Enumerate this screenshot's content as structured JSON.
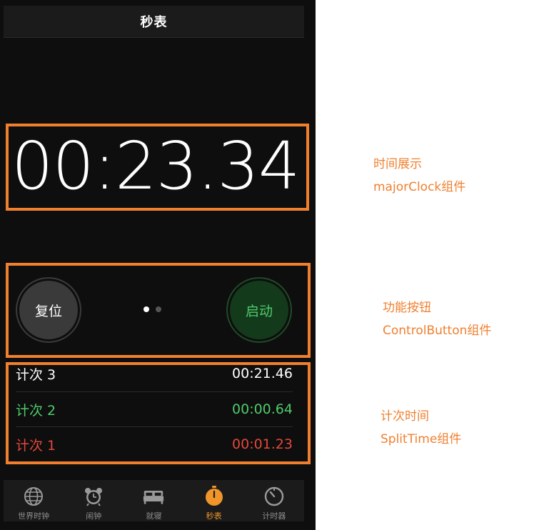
{
  "header": {
    "title": "秒表"
  },
  "clock": {
    "display": "00:23.34"
  },
  "controls": {
    "reset_label": "复位",
    "start_label": "启动",
    "page_dots": 2,
    "active_dot": 1
  },
  "laps": [
    {
      "label": "计次 3",
      "time": "00:21.46",
      "color": "#ffffff"
    },
    {
      "label": "计次 2",
      "time": "00:00.64",
      "color": "#4ecb6b"
    },
    {
      "label": "计次 1",
      "time": "00:01.23",
      "color": "#e4473b"
    }
  ],
  "tabbar": {
    "items": [
      {
        "label": "世界时钟",
        "icon": "globe-icon",
        "active": false
      },
      {
        "label": "闹钟",
        "icon": "alarm-clock-icon",
        "active": false
      },
      {
        "label": "就寝",
        "icon": "bed-icon",
        "active": false
      },
      {
        "label": "秒表",
        "icon": "stopwatch-icon",
        "active": true
      },
      {
        "label": "计时器",
        "icon": "timer-icon",
        "active": false
      }
    ]
  },
  "annotations": {
    "clock": {
      "line1": "时间展示",
      "line2": "majorClock组件"
    },
    "controls": {
      "line1": "功能按钮",
      "line2": "ControlButton组件"
    },
    "splits": {
      "line1": "计次时间",
      "line2": "SplitTime组件"
    }
  },
  "colors": {
    "accent": "#f0952a",
    "annotation": "#f07f2e",
    "start_green": "#4ecb6b",
    "lap_red": "#e4473b",
    "background": "#0e0e0e"
  }
}
